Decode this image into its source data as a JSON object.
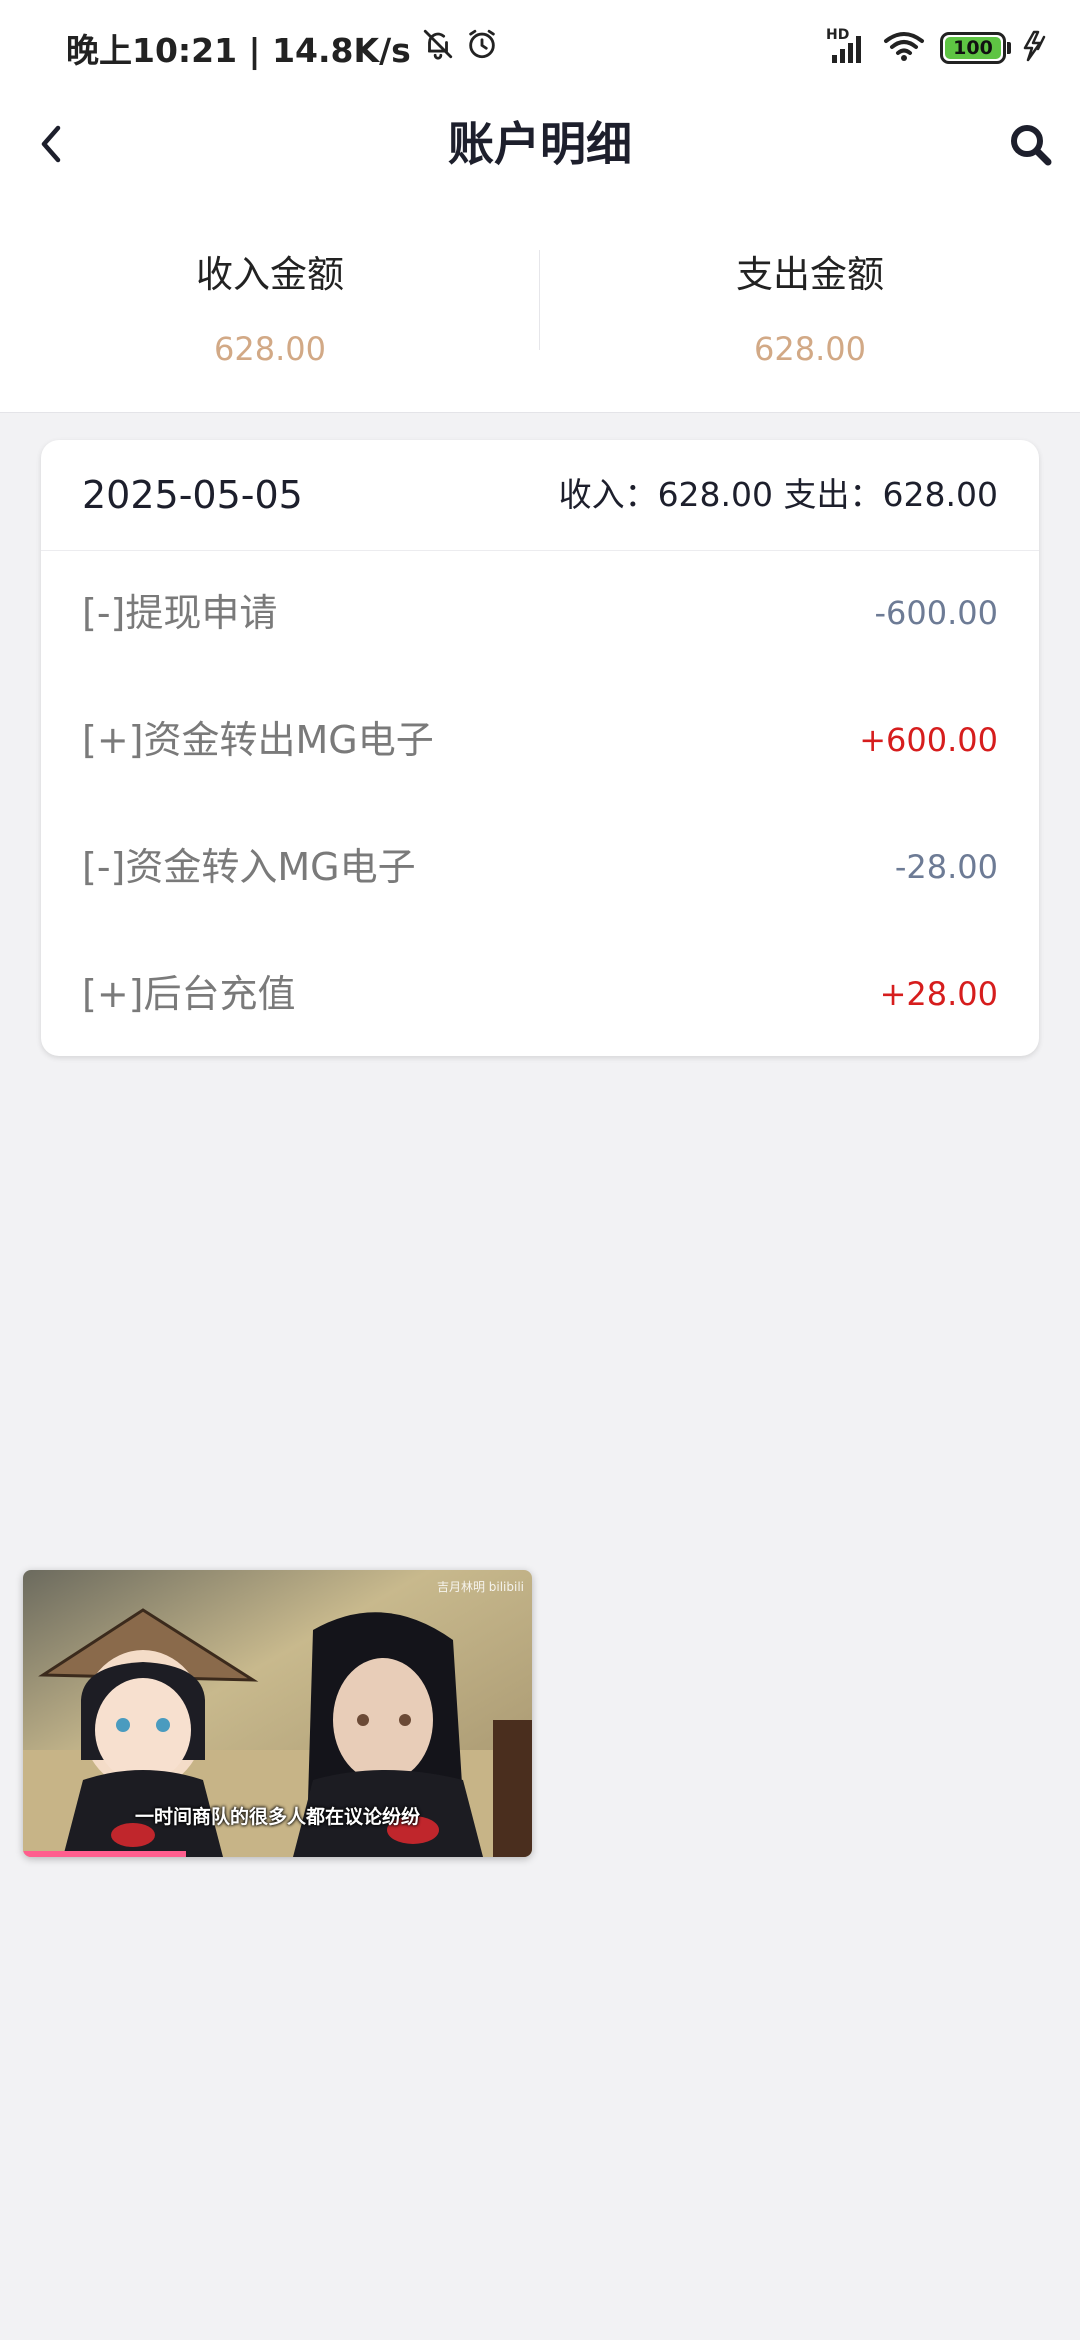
{
  "status_bar": {
    "time_speed": "晚上10:21 | 14.8K/s",
    "hd": "HD",
    "battery_level": "100",
    "battery_fraction": 1.0,
    "icons": [
      "mute-bell-icon",
      "alarm-icon",
      "signal-icon",
      "wifi-icon",
      "battery-icon",
      "charging-icon"
    ]
  },
  "header": {
    "title": "账户明细",
    "back_icon": "chevron-left-icon",
    "search_icon": "search-icon"
  },
  "summary": {
    "income_label": "收入金额",
    "income_value": "628.00",
    "expense_label": "支出金额",
    "expense_value": "628.00"
  },
  "card": {
    "date": "2025-05-05",
    "day_summary": "收入：628.00 支出：628.00",
    "transactions": [
      {
        "desc": "[-]提现申请",
        "amount": "-600.00",
        "kind": "out"
      },
      {
        "desc": "[+]资金转出MG电子",
        "amount": "+600.00",
        "kind": "in"
      },
      {
        "desc": "[-]资金转入MG电子",
        "amount": "-28.00",
        "kind": "out"
      },
      {
        "desc": "[+]后台充值",
        "amount": "+28.00",
        "kind": "in"
      }
    ]
  },
  "video": {
    "caption": "一时间商队的很多人都在议论纷纷",
    "watermark": "吉月林明 bilibili",
    "progress_fraction": 0.32
  },
  "colors": {
    "accent_amount": "#d2a986",
    "in_amount": "#d61d1d",
    "out_amount": "#6d7b95",
    "background": "#f2f2f4"
  }
}
